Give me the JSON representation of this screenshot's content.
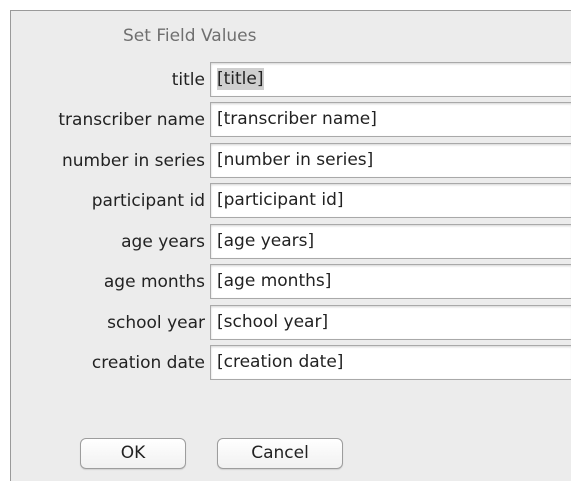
{
  "dialog": {
    "title": "Set Field Values",
    "fields": [
      {
        "label": "title",
        "value": "[title]"
      },
      {
        "label": "transcriber name",
        "value": "[transcriber name]"
      },
      {
        "label": "number in series",
        "value": "[number in series]"
      },
      {
        "label": "participant id",
        "value": "[participant id]"
      },
      {
        "label": "age years",
        "value": "[age years]"
      },
      {
        "label": "age months",
        "value": "[age months]"
      },
      {
        "label": "school year",
        "value": "[school year]"
      },
      {
        "label": "creation date",
        "value": "[creation date]"
      }
    ],
    "ok_label": "OK",
    "cancel_label": "Cancel"
  }
}
